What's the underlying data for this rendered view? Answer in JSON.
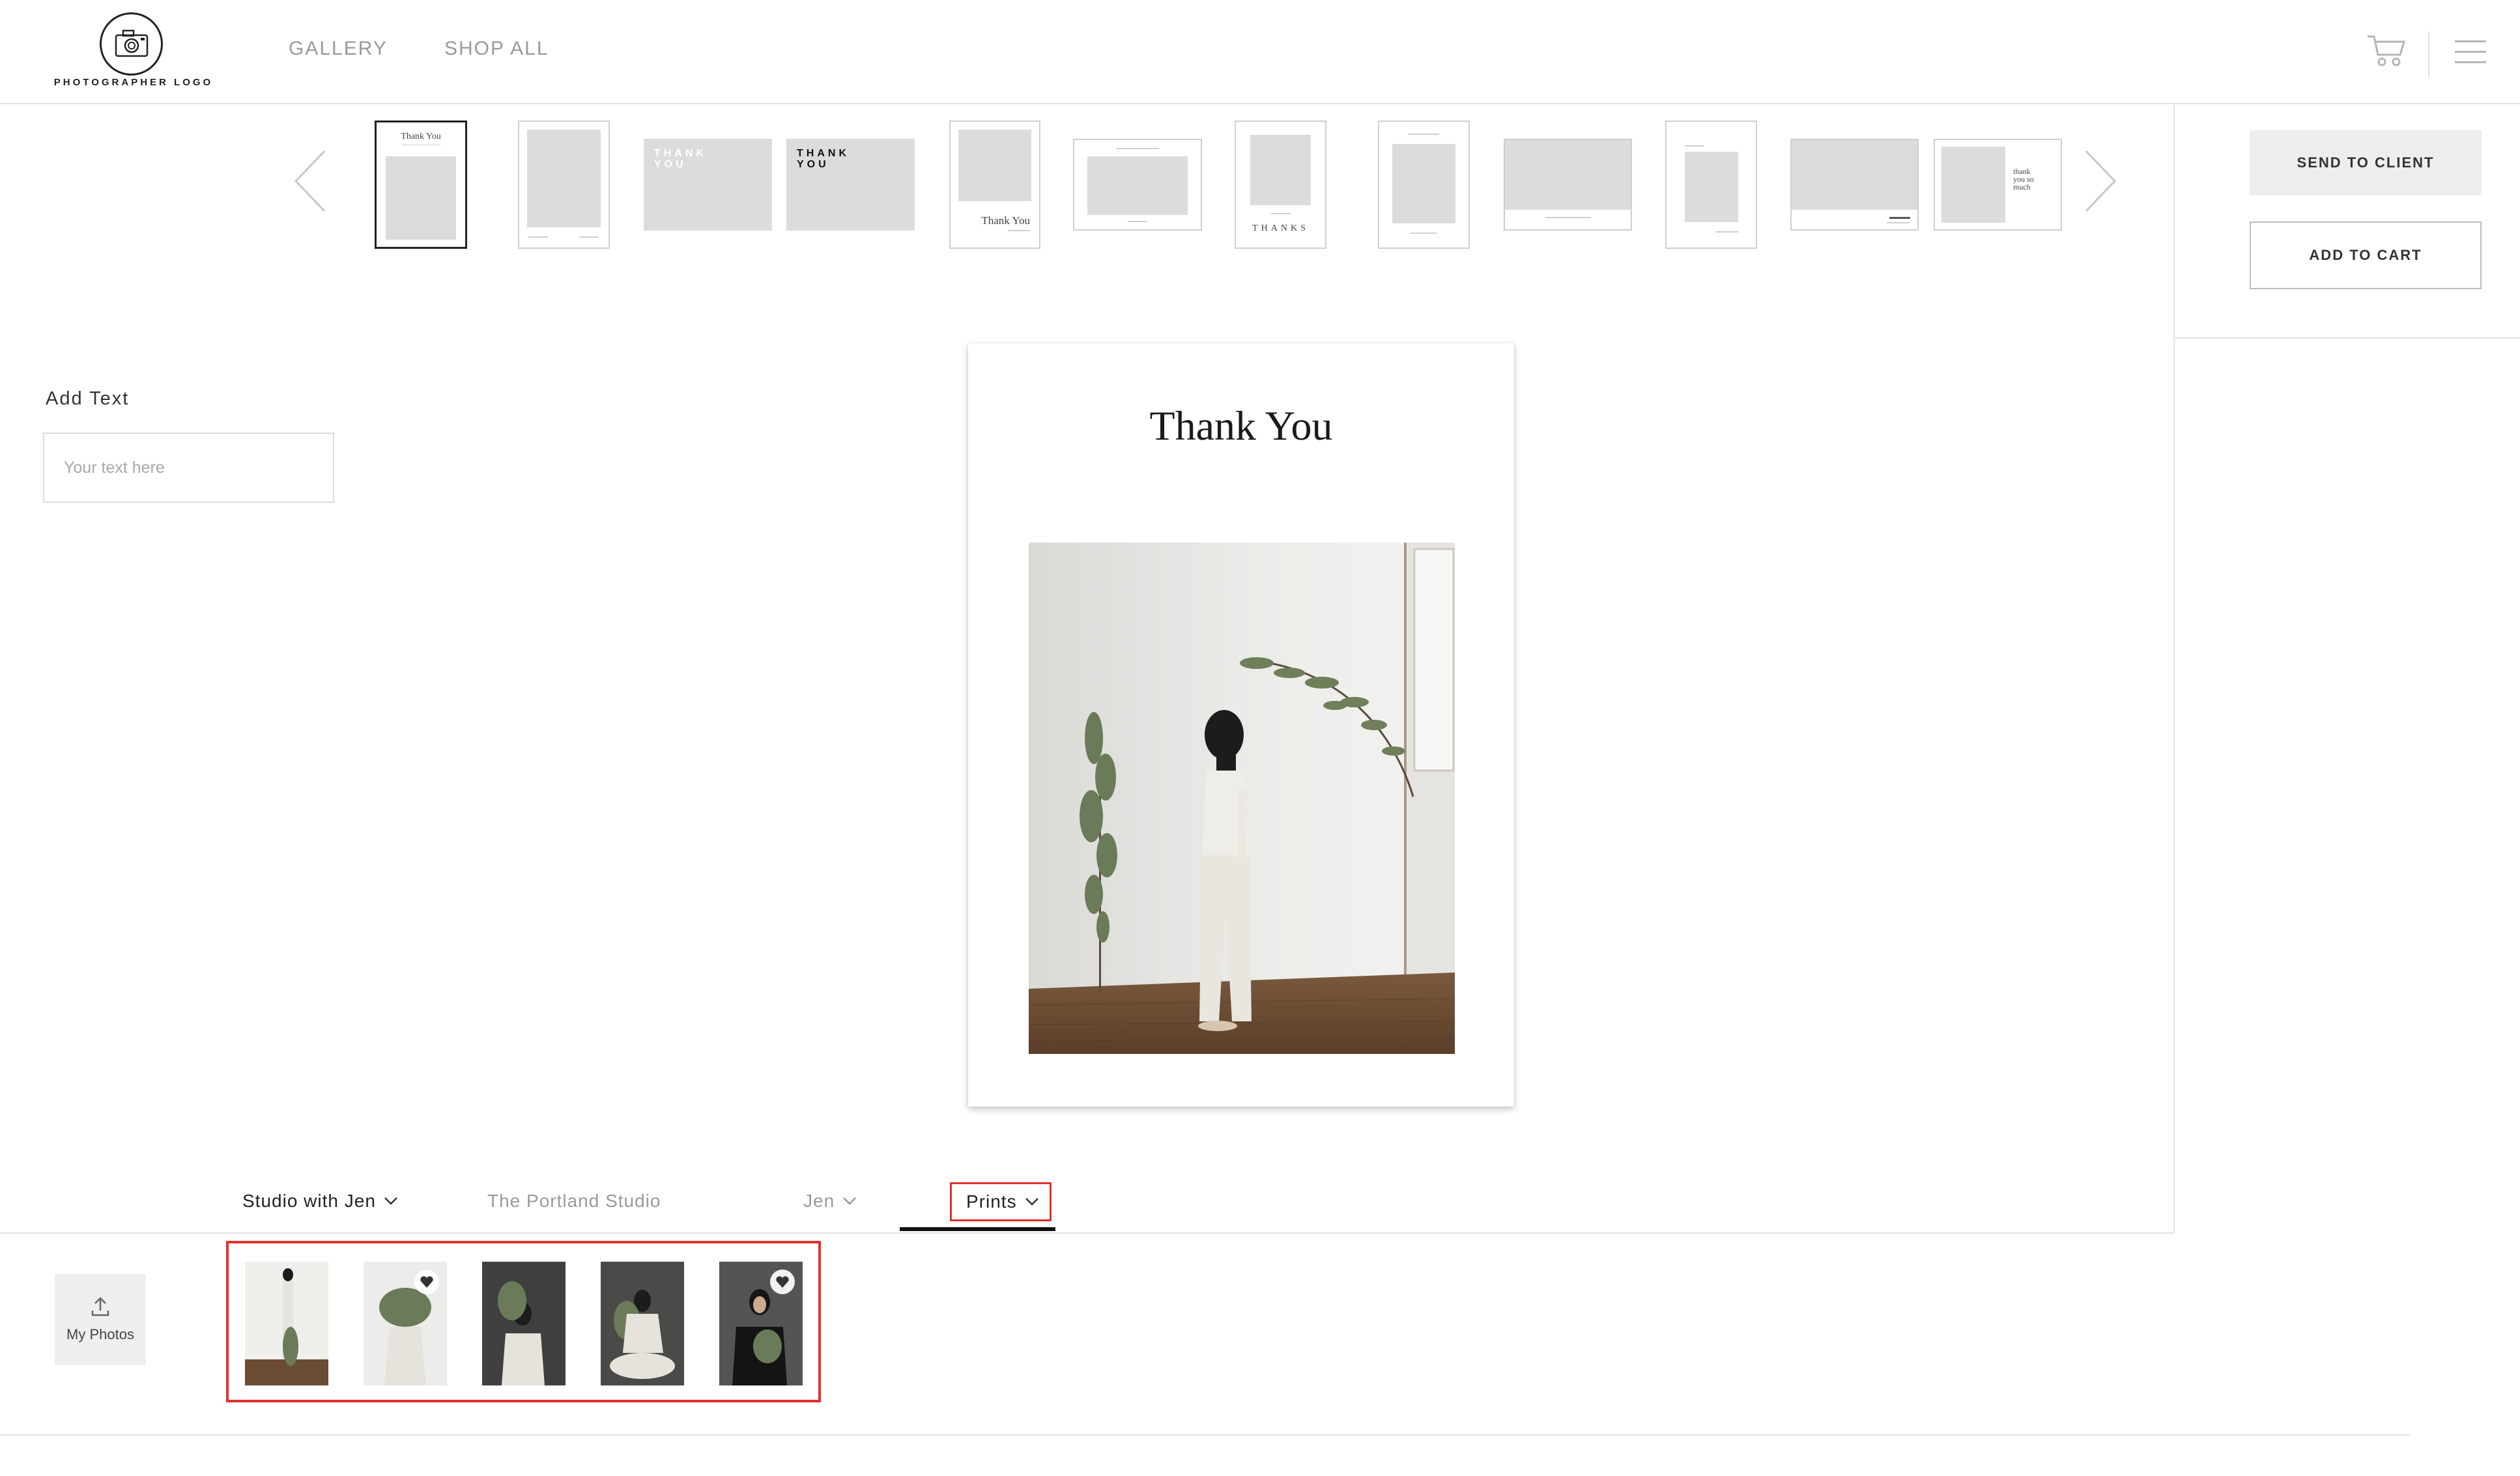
{
  "header": {
    "logo_text": "PHOTOGRAPHER LOGO",
    "nav": [
      "GALLERY",
      "SHOP ALL"
    ]
  },
  "templates": {
    "prev_icon": "chevron-left-icon",
    "next_icon": "chevron-right-icon",
    "selected_index": 0,
    "labels": {
      "t0": "Thank You",
      "t2": "THANK YOU",
      "t3": "THANK YOU",
      "t4": "Thank You",
      "t6": "THANKS",
      "t11": "thank you so much"
    }
  },
  "actions": {
    "send_to_client": "SEND TO CLIENT",
    "add_to_cart": "ADD TO CART"
  },
  "add_text": {
    "label": "Add Text",
    "placeholder": "Your text here"
  },
  "card": {
    "title": "Thank You"
  },
  "tabs": {
    "items": [
      "Studio with Jen",
      "The Portland Studio",
      "Jen",
      "Prints"
    ],
    "active": "Prints"
  },
  "photos": {
    "upload_label": "My Photos",
    "favorites": [
      false,
      true,
      false,
      false,
      true
    ]
  },
  "colors": {
    "highlight": "#e0332b",
    "placeholder_gray": "#dcdcdc"
  }
}
